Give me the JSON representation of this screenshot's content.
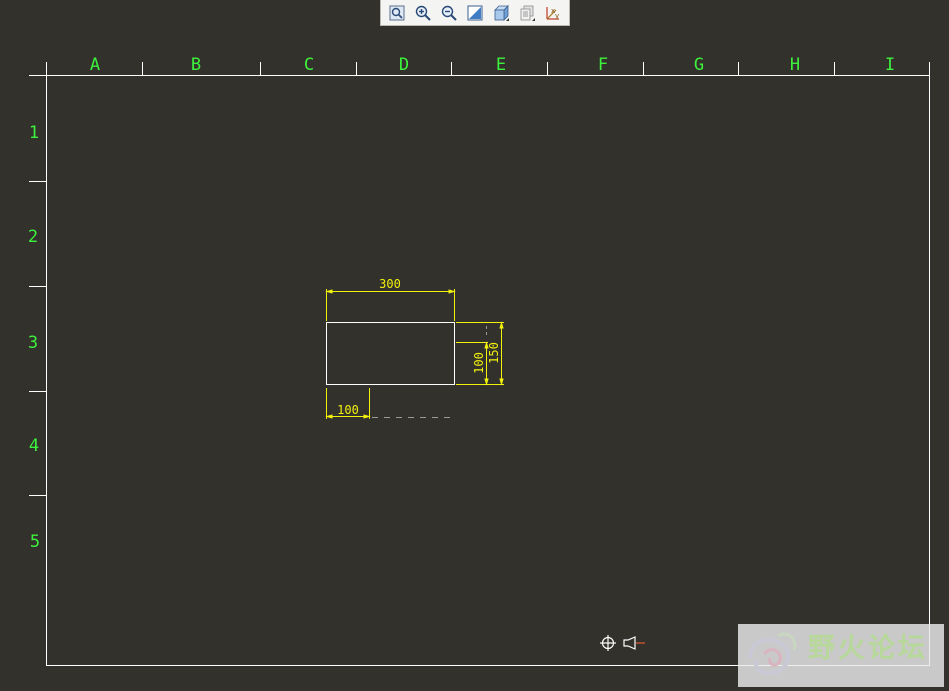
{
  "toolbar": {
    "buttons": [
      {
        "name": "refit-icon"
      },
      {
        "name": "zoom-in-icon"
      },
      {
        "name": "zoom-out-icon"
      },
      {
        "name": "repaint-icon"
      },
      {
        "name": "shading-icon"
      },
      {
        "name": "layers-icon"
      },
      {
        "name": "datum-display-icon"
      }
    ]
  },
  "drawing": {
    "columns": [
      "A",
      "B",
      "C",
      "D",
      "E",
      "F",
      "G",
      "H",
      "I"
    ],
    "rows": [
      "1",
      "2",
      "3",
      "4",
      "5"
    ],
    "dimensions": {
      "width": "300",
      "height_inner": "100",
      "height_outer": "150",
      "offset": "100"
    },
    "colors": {
      "grid_label": "#3df23d",
      "border": "#ffffff",
      "dimension": "#f2f20d",
      "background": "#32312c"
    }
  },
  "watermark": {
    "title": "野火论坛",
    "url": "www.proewildfire.cn"
  }
}
